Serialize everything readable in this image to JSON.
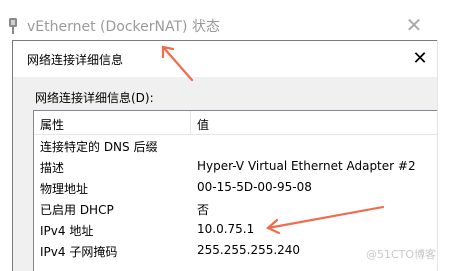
{
  "background_window": {
    "title": "vEthernet (DockerNAT) 状态",
    "close_glyph": "✕"
  },
  "dialog": {
    "title": "网络连接详细信息",
    "close_glyph": "✕",
    "group_label": "网络连接详细信息(D):",
    "columns": [
      "属性",
      "值"
    ],
    "rows": [
      {
        "property": "连接特定的 DNS 后缀",
        "value": ""
      },
      {
        "property": "描述",
        "value": "Hyper-V Virtual Ethernet Adapter #2"
      },
      {
        "property": "物理地址",
        "value": "00-15-5D-00-95-08"
      },
      {
        "property": "已启用 DHCP",
        "value": "否"
      },
      {
        "property": "IPv4 地址",
        "value": "10.0.75.1"
      },
      {
        "property": "IPv4 子网掩码",
        "value": "255.255.255.240"
      }
    ]
  },
  "watermark": "@51CTO博客",
  "colors": {
    "annotation_arrow": "#f26b4a",
    "dialog_bg": "#f0f0f0",
    "list_border": "#828790"
  }
}
